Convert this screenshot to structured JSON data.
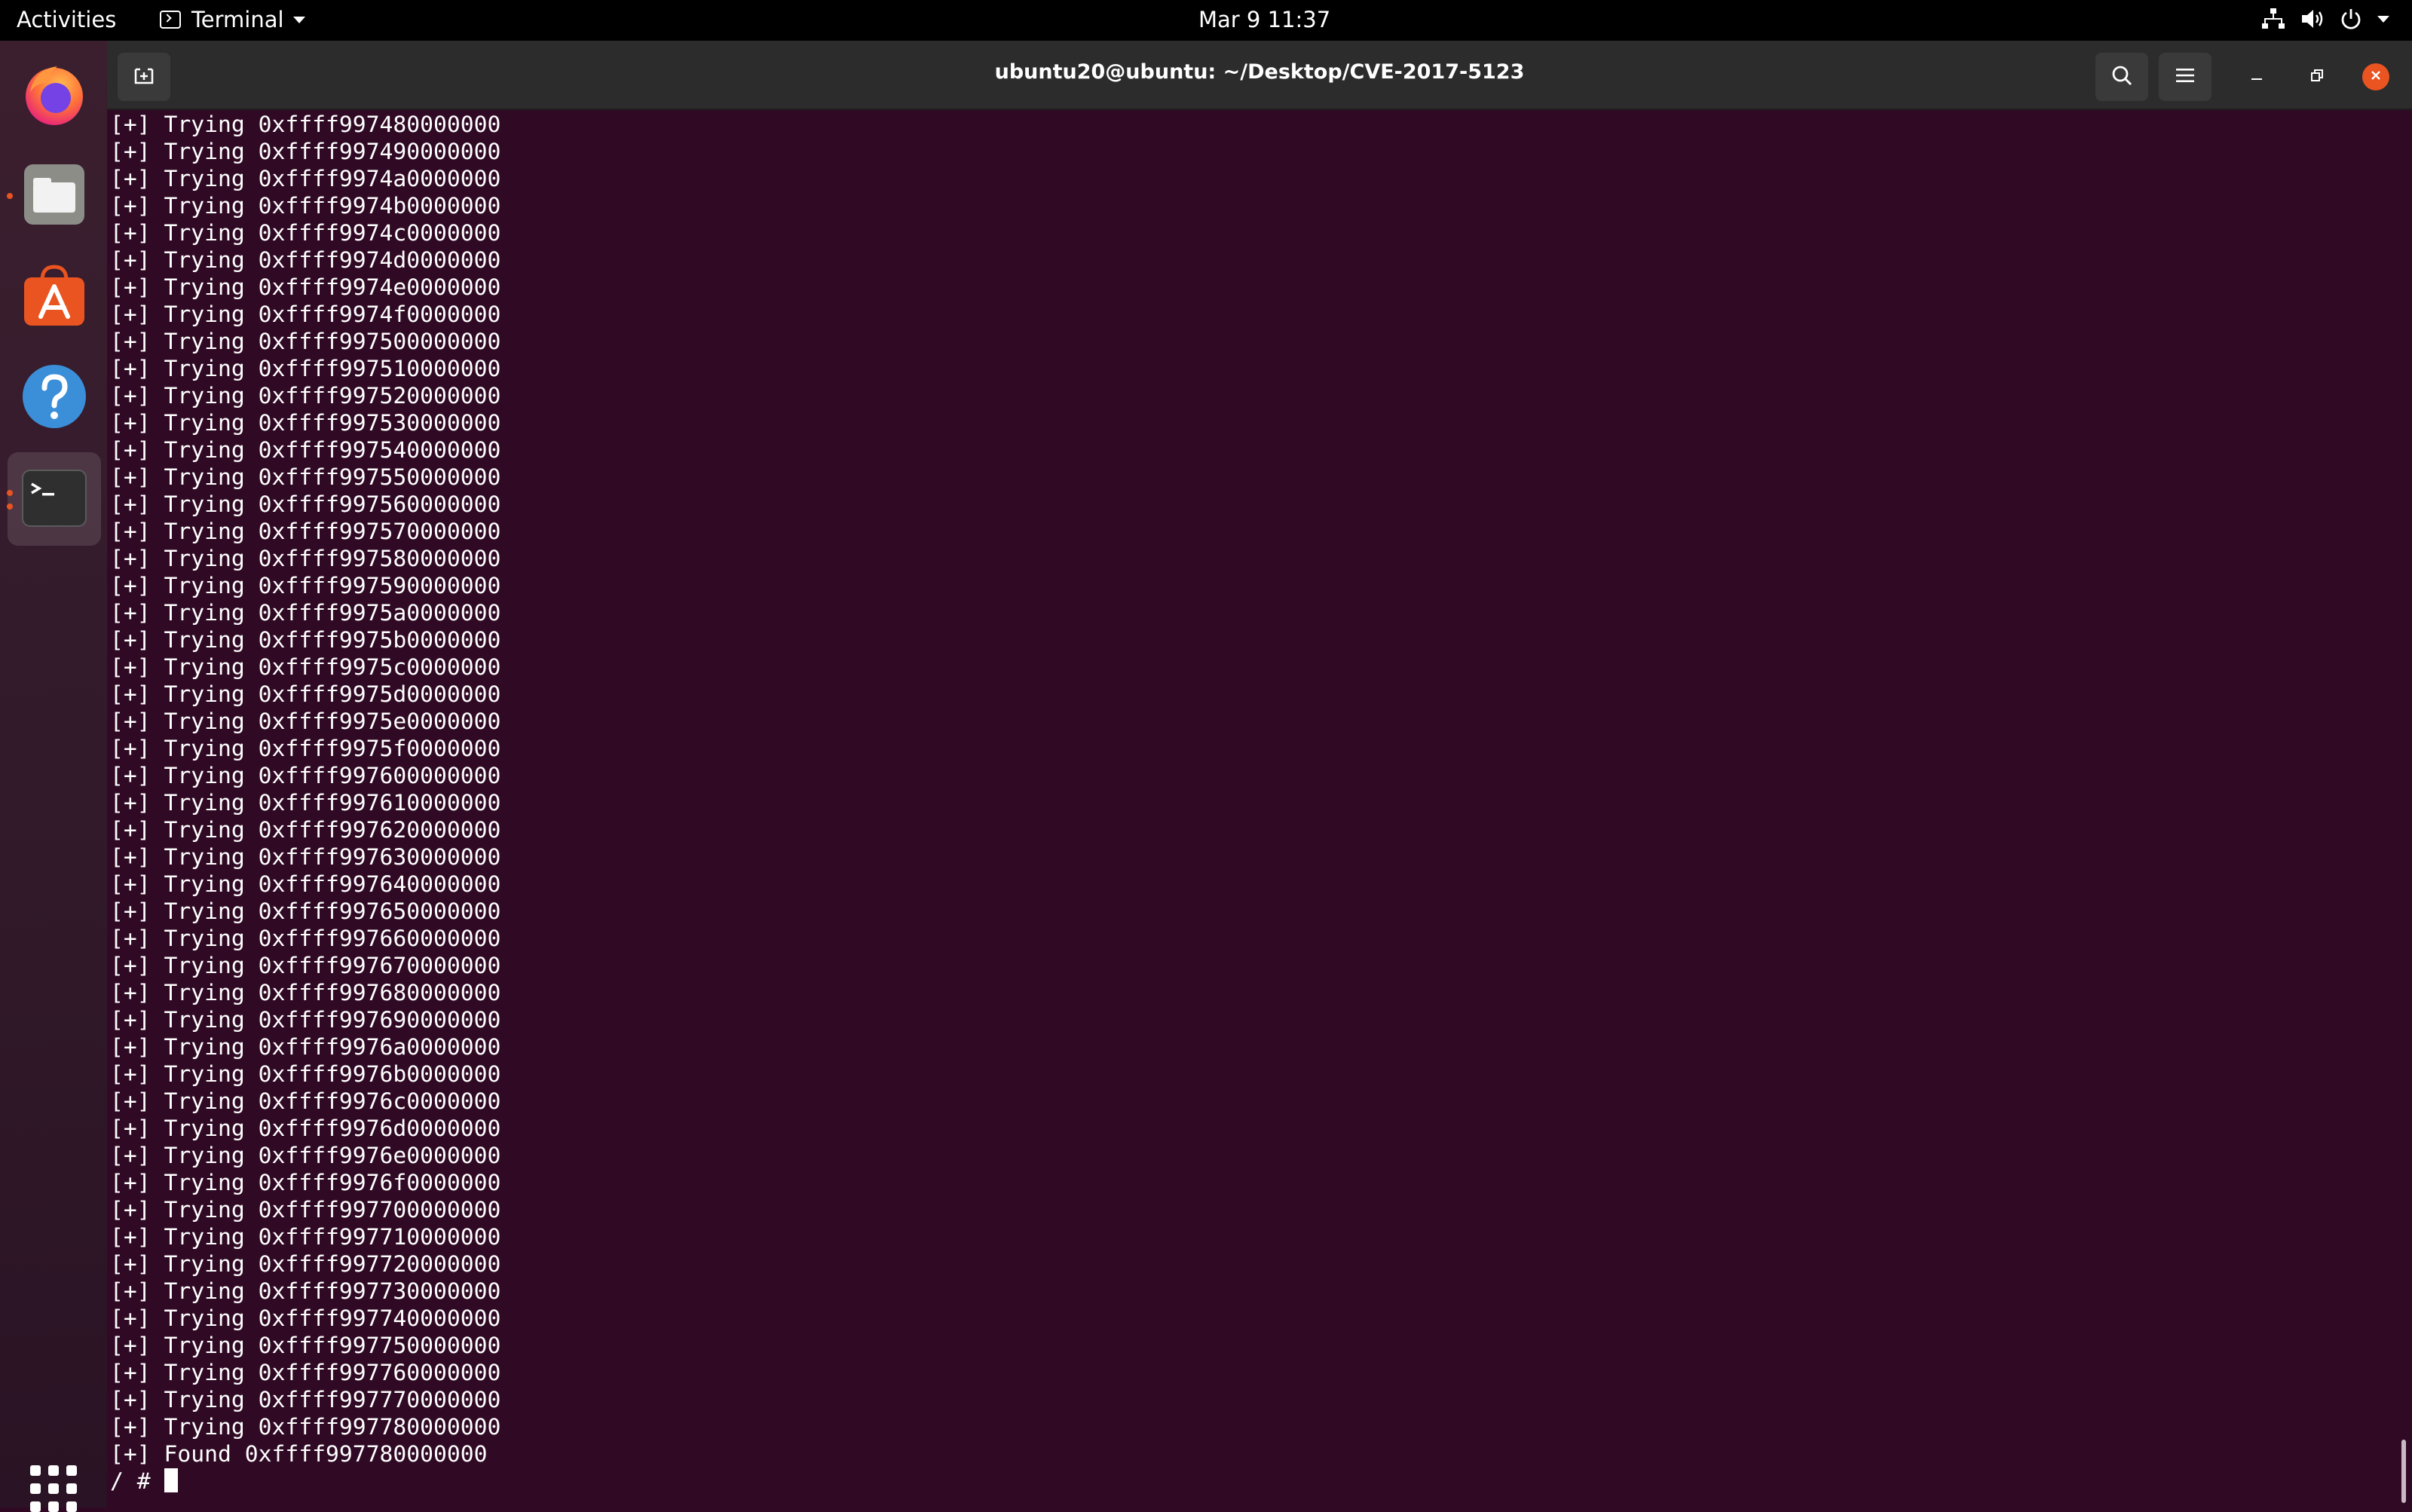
{
  "topbar": {
    "activities": "Activities",
    "app_name": "Terminal",
    "clock": "Mar 9  11:37"
  },
  "dock": {
    "items": [
      "firefox",
      "files",
      "ubuntu-software",
      "help",
      "terminal"
    ]
  },
  "window": {
    "title": "ubuntu20@ubuntu: ~/Desktop/CVE-2017-5123"
  },
  "terminal": {
    "lines": [
      "[+] Trying 0xffff997480000000",
      "[+] Trying 0xffff997490000000",
      "[+] Trying 0xffff9974a0000000",
      "[+] Trying 0xffff9974b0000000",
      "[+] Trying 0xffff9974c0000000",
      "[+] Trying 0xffff9974d0000000",
      "[+] Trying 0xffff9974e0000000",
      "[+] Trying 0xffff9974f0000000",
      "[+] Trying 0xffff997500000000",
      "[+] Trying 0xffff997510000000",
      "[+] Trying 0xffff997520000000",
      "[+] Trying 0xffff997530000000",
      "[+] Trying 0xffff997540000000",
      "[+] Trying 0xffff997550000000",
      "[+] Trying 0xffff997560000000",
      "[+] Trying 0xffff997570000000",
      "[+] Trying 0xffff997580000000",
      "[+] Trying 0xffff997590000000",
      "[+] Trying 0xffff9975a0000000",
      "[+] Trying 0xffff9975b0000000",
      "[+] Trying 0xffff9975c0000000",
      "[+] Trying 0xffff9975d0000000",
      "[+] Trying 0xffff9975e0000000",
      "[+] Trying 0xffff9975f0000000",
      "[+] Trying 0xffff997600000000",
      "[+] Trying 0xffff997610000000",
      "[+] Trying 0xffff997620000000",
      "[+] Trying 0xffff997630000000",
      "[+] Trying 0xffff997640000000",
      "[+] Trying 0xffff997650000000",
      "[+] Trying 0xffff997660000000",
      "[+] Trying 0xffff997670000000",
      "[+] Trying 0xffff997680000000",
      "[+] Trying 0xffff997690000000",
      "[+] Trying 0xffff9976a0000000",
      "[+] Trying 0xffff9976b0000000",
      "[+] Trying 0xffff9976c0000000",
      "[+] Trying 0xffff9976d0000000",
      "[+] Trying 0xffff9976e0000000",
      "[+] Trying 0xffff9976f0000000",
      "[+] Trying 0xffff997700000000",
      "[+] Trying 0xffff997710000000",
      "[+] Trying 0xffff997720000000",
      "[+] Trying 0xffff997730000000",
      "[+] Trying 0xffff997740000000",
      "[+] Trying 0xffff997750000000",
      "[+] Trying 0xffff997760000000",
      "[+] Trying 0xffff997770000000",
      "[+] Trying 0xffff997780000000",
      "[+] Found 0xffff997780000000"
    ],
    "prompt": "/ # "
  },
  "colors": {
    "terminal_bg": "#300a24",
    "accent": "#e95420",
    "headerbar": "#2c2c2c"
  }
}
